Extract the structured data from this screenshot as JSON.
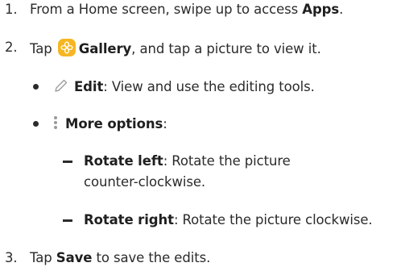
{
  "steps": [
    {
      "number": "1.",
      "text_before": "From a Home screen, swipe up to access ",
      "bold": "Apps",
      "text_after": "."
    },
    {
      "number": "2.",
      "text_before": "Tap ",
      "icon": "gallery-app-icon",
      "bold": "Gallery",
      "text_after": ", and tap a picture to view it."
    },
    {
      "number": "3.",
      "text_before": "Tap ",
      "bold": "Save",
      "text_after": " to save the edits."
    }
  ],
  "bullets": [
    {
      "icon": "pencil-icon",
      "bold": "Edit",
      "text": ": View and use the editing tools."
    },
    {
      "icon": "more-options-icon",
      "bold": "More options",
      "text": ":"
    }
  ],
  "sub_items": [
    {
      "bold": "Rotate left",
      "text_line1": ": Rotate the picture",
      "text_line2": "counter-clockwise."
    },
    {
      "bold": "Rotate right",
      "text_line1": ": Rotate the picture clockwise."
    }
  ],
  "colors": {
    "text": "#2b2b2b",
    "gallery_icon": "#f6b623"
  }
}
